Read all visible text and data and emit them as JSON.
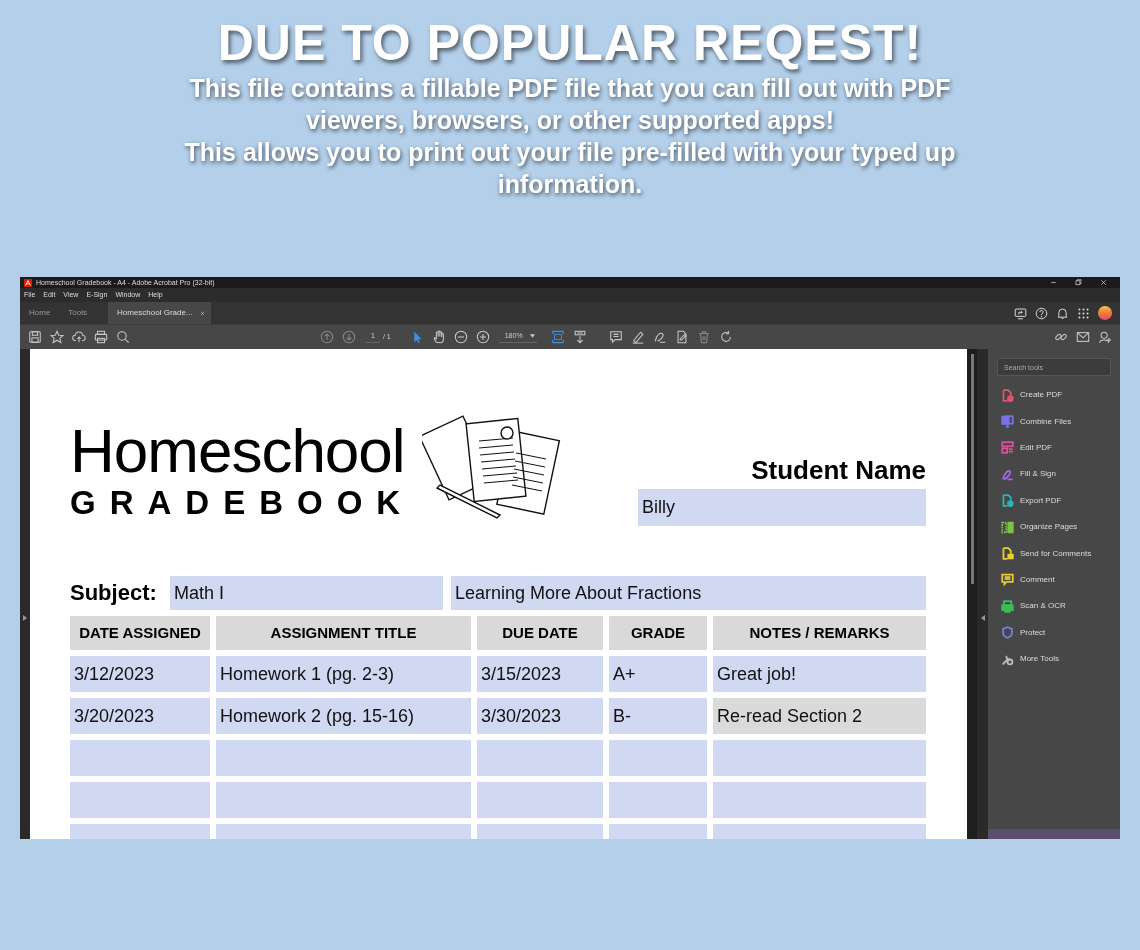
{
  "headline": "DUE TO POPULAR REQEST!",
  "description": [
    "This file contains a fillable PDF file that you can fill out with PDF viewers, browsers, or other supported apps!",
    "This allows you to print out your file pre-filled with your typed up information."
  ],
  "window": {
    "title": "Homeschool Gradebook - A4 - Adobe Acrobat Pro (32-bit)",
    "menu": [
      "File",
      "Edit",
      "View",
      "E-Sign",
      "Window",
      "Help"
    ],
    "tabs": [
      {
        "label": "Home",
        "selected": false,
        "kind": "nav"
      },
      {
        "label": "Tools",
        "selected": false,
        "kind": "nav"
      },
      {
        "label": "Homeschool Grade...",
        "selected": true,
        "kind": "document"
      }
    ],
    "page_number": "1",
    "page_total": "/ 1",
    "zoom": "180%",
    "tools_panel": {
      "search": {
        "placeholder": "Search tools"
      },
      "items": [
        {
          "label": "Create PDF",
          "color": "#e0566a"
        },
        {
          "label": "Combine Files",
          "color": "#7b72e6"
        },
        {
          "label": "Edit PDF",
          "color": "#dc4f9c"
        },
        {
          "label": "Fill & Sign",
          "color": "#9b6ae0"
        },
        {
          "label": "Export PDF",
          "color": "#2bb3bd"
        },
        {
          "label": "Organize Pages",
          "color": "#7cc443"
        },
        {
          "label": "Send for Comments",
          "color": "#e6d22e"
        },
        {
          "label": "Comment",
          "color": "#e8c92e"
        },
        {
          "label": "Scan & OCR",
          "color": "#3dbd55"
        },
        {
          "label": "Protect",
          "color": "#7d7de3"
        },
        {
          "label": "More Tools",
          "color": "#bdbdbd"
        }
      ]
    }
  },
  "document": {
    "title": "Homeschool",
    "subtitle": "GRADEBOOK",
    "student_label": "Student Name",
    "student_name": "Billy",
    "subject_label": "Subject:",
    "subject": "Math I",
    "topic": "Learning More About Fractions",
    "columns": [
      "DATE ASSIGNED",
      "ASSIGNMENT TITLE",
      "DUE DATE",
      "GRADE",
      "NOTES / REMARKS"
    ],
    "rows": [
      {
        "kind": "filled",
        "cells": [
          {
            "value": "3/12/2023",
            "focused": false
          },
          {
            "value": "Homework 1 (pg. 2-3)",
            "focused": false
          },
          {
            "value": "3/15/2023",
            "focused": false
          },
          {
            "value": "A+",
            "focused": false
          },
          {
            "value": "Great job!",
            "focused": false
          }
        ]
      },
      {
        "kind": "filled",
        "cells": [
          {
            "value": "3/20/2023",
            "focused": false
          },
          {
            "value": "Homework 2 (pg. 15-16)",
            "focused": false
          },
          {
            "value": "3/30/2023",
            "focused": false
          },
          {
            "value": "B-",
            "focused": false
          },
          {
            "value": "Re-read Section 2",
            "focused": true
          }
        ]
      },
      {
        "kind": "blank"
      },
      {
        "kind": "blank"
      },
      {
        "kind": "blank"
      }
    ]
  }
}
